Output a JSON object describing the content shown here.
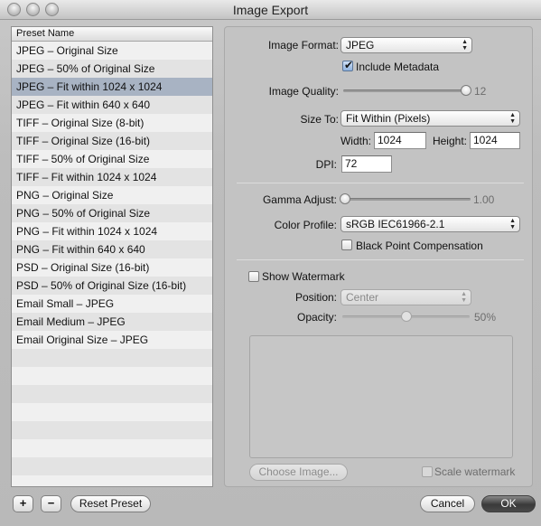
{
  "window": {
    "title": "Image Export"
  },
  "presets": {
    "header": "Preset Name",
    "selected_index": 2,
    "items": [
      "JPEG – Original Size",
      "JPEG – 50% of Original Size",
      "JPEG – Fit within 1024 x 1024",
      "JPEG – Fit within 640 x 640",
      "TIFF – Original Size (8-bit)",
      "TIFF – Original Size (16-bit)",
      "TIFF – 50% of Original Size",
      "TIFF – Fit within 1024 x 1024",
      "PNG – Original Size",
      "PNG – 50% of Original Size",
      "PNG – Fit within 1024 x 1024",
      "PNG – Fit within 640 x 640",
      "PSD – Original Size (16-bit)",
      "PSD – 50% of Original Size (16-bit)",
      "Email Small – JPEG",
      "Email Medium – JPEG",
      "Email Original Size – JPEG"
    ]
  },
  "format": {
    "label": "Image Format:",
    "value": "JPEG",
    "include_metadata_label": "Include Metadata",
    "include_metadata_checked": true
  },
  "quality": {
    "label": "Image Quality:",
    "value": "12",
    "level_fraction": 1.0
  },
  "size": {
    "label": "Size To:",
    "value": "Fit Within (Pixels)",
    "width_label": "Width:",
    "width_value": "1024",
    "height_label": "Height:",
    "height_value": "1024",
    "dpi_label": "DPI:",
    "dpi_value": "72"
  },
  "gamma": {
    "label": "Gamma Adjust:",
    "value": "1.00",
    "level_fraction": 0.0
  },
  "color_profile": {
    "label": "Color Profile:",
    "value": "sRGB IEC61966-2.1",
    "black_point_label": "Black Point Compensation",
    "black_point_checked": false
  },
  "watermark": {
    "show_label": "Show Watermark",
    "show_checked": false,
    "position_label": "Position:",
    "position_value": "Center",
    "opacity_label": "Opacity:",
    "opacity_value": "50%",
    "opacity_fraction": 0.5,
    "choose_image_label": "Choose Image...",
    "scale_label": "Scale watermark",
    "scale_checked": false
  },
  "buttons": {
    "add": "+",
    "remove": "−",
    "reset_preset": "Reset Preset",
    "cancel": "Cancel",
    "ok": "OK"
  }
}
